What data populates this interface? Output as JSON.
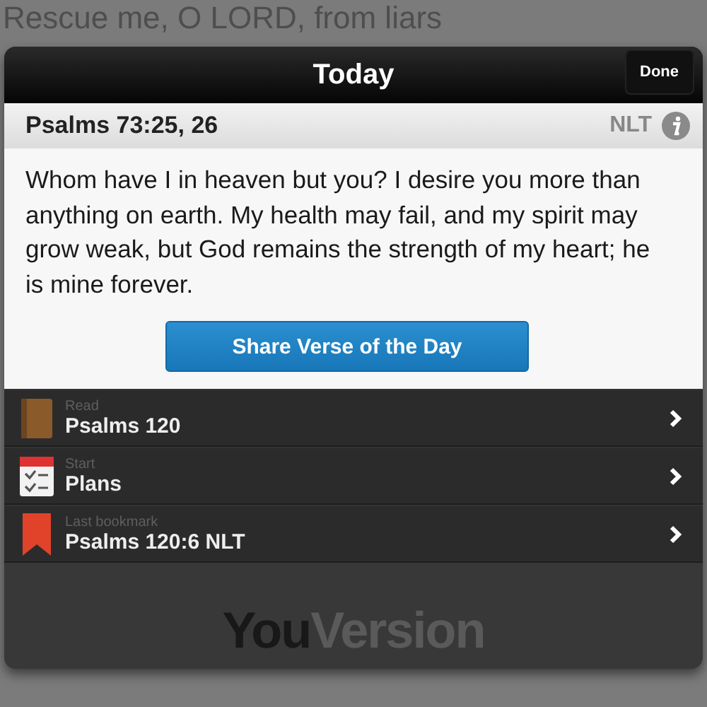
{
  "background_text": "Rescue me, O LORD, from liars",
  "window": {
    "title": "Today",
    "done_button": "Done"
  },
  "verse": {
    "reference": "Psalms 73:25, 26",
    "translation": "NLT",
    "text": "Whom have I in heaven but you? I desire you more than anything on earth. My health may fail, and my spirit may grow weak, but God remains the strength of my heart; he is mine forever.",
    "share_button": "Share Verse of the Day"
  },
  "items": [
    {
      "kind": "book",
      "caption": "Read",
      "title": "Psalms 120"
    },
    {
      "kind": "plans",
      "caption": "Start",
      "title": "Plans"
    },
    {
      "kind": "bookmark",
      "caption": "Last bookmark",
      "title": "Psalms 120:6 NLT"
    }
  ],
  "logo": {
    "first": "You",
    "second": "Version"
  }
}
